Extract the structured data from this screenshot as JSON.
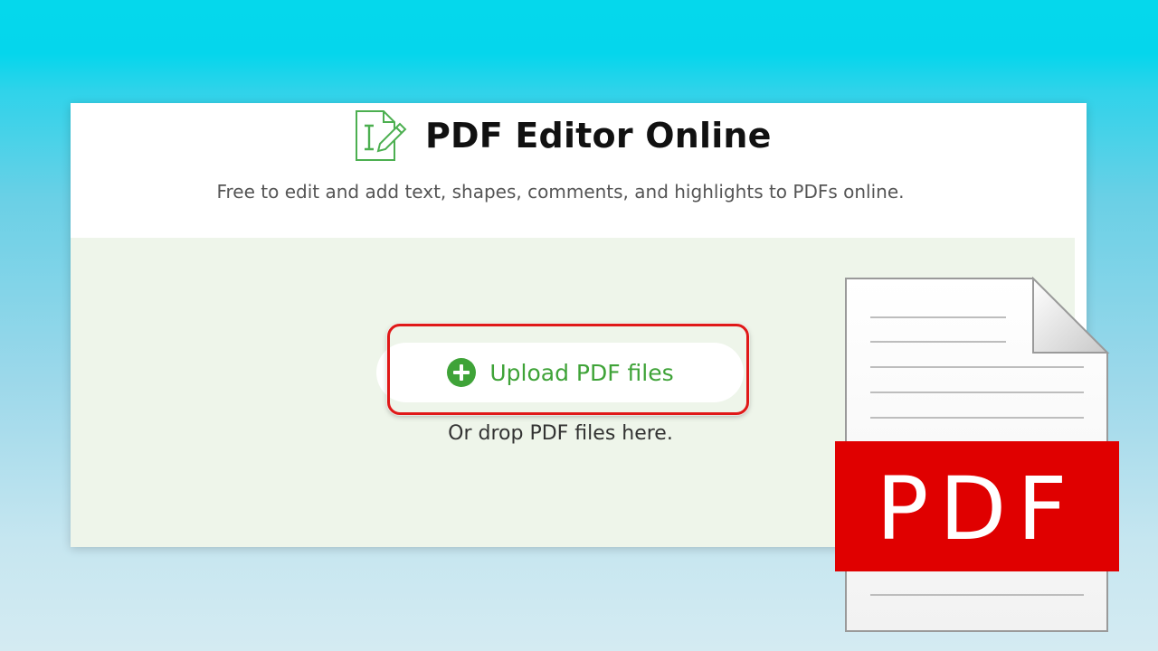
{
  "header": {
    "title": "PDF Editor Online",
    "subtitle": "Free to edit and add text, shapes, comments, and highlights to PDFs online.",
    "logo_icon": "edit-document-icon"
  },
  "upload": {
    "button_label": "Upload PDF files",
    "button_icon": "plus-circle-icon",
    "drop_hint": "Or drop PDF files here."
  },
  "pdf_file_graphic": {
    "label": "PDF",
    "icon": "pdf-file-icon"
  },
  "colors": {
    "background_top": "#05d8ec",
    "background_bottom": "#d4ebf2",
    "drop_zone": "#eef5ea",
    "accent_green": "#3fa338",
    "highlight_red": "#e01818",
    "pdf_red": "#e00000"
  }
}
